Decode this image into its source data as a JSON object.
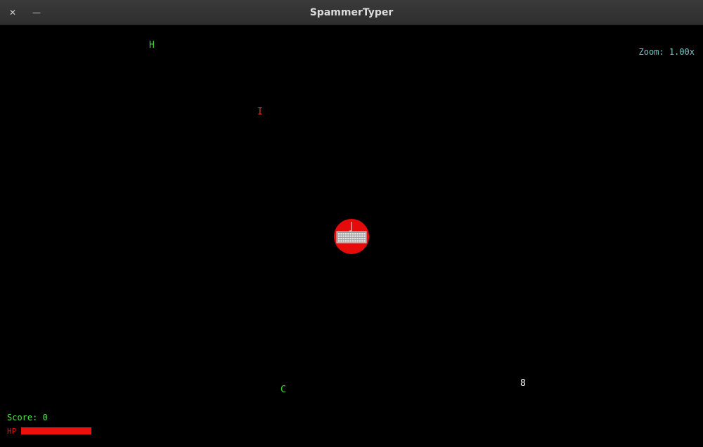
{
  "window": {
    "title": "SpammerTyper",
    "close_glyph": "✕",
    "minimize_glyph": "—"
  },
  "hud": {
    "zoom_text": "Zoom: 1.00x",
    "score_label": "Score:",
    "score_value": "0",
    "hp_label": "HP",
    "hp_fraction": 1.0
  },
  "letters": [
    {
      "char": "H",
      "color": "#3fd43f"
    },
    {
      "char": "I",
      "color": "#e03030"
    },
    {
      "char": "C",
      "color": "#3fd43f"
    },
    {
      "char": "8",
      "color": "#ffffff"
    }
  ],
  "player": {
    "icon": "keyboard-icon",
    "color": "#e50b0b"
  }
}
